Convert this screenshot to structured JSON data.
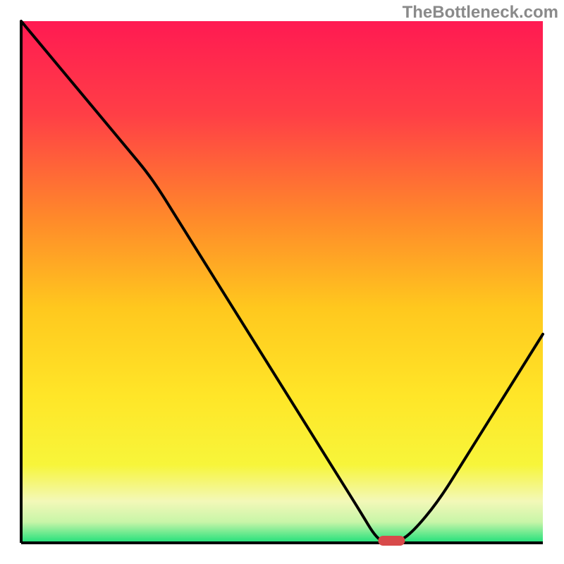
{
  "watermark": "TheBottleneck.com",
  "chart_data": {
    "type": "line",
    "title": "",
    "xlabel": "",
    "ylabel": "",
    "xlim": [
      0,
      100
    ],
    "ylim": [
      0,
      100
    ],
    "x": [
      0,
      5,
      10,
      15,
      20,
      25,
      30,
      35,
      40,
      45,
      50,
      55,
      60,
      65,
      68,
      70,
      72,
      75,
      80,
      85,
      90,
      95,
      100
    ],
    "values": [
      100,
      94,
      88,
      82,
      76,
      70,
      62,
      54,
      46,
      38,
      30,
      22,
      14,
      6,
      1,
      0,
      0,
      2,
      8,
      16,
      24,
      32,
      40
    ],
    "marker_point": {
      "x": 71,
      "y": 0
    },
    "gradient": {
      "top_color": "#ff1a52",
      "upper_mid_color": "#ff6a34",
      "mid_color": "#ffc81e",
      "lower_mid_color": "#f7f53a",
      "bottom_band_color": "#f3f8b8",
      "baseline_color": "#1ee07a"
    }
  }
}
